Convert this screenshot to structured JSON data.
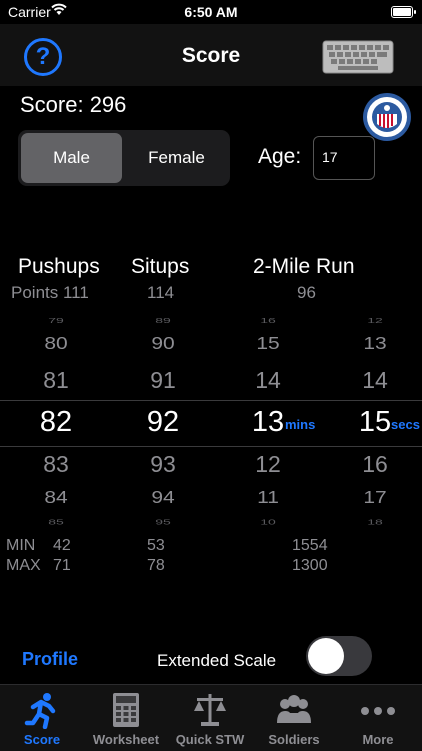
{
  "status_bar": {
    "carrier": "Carrier",
    "time": "6:50 AM"
  },
  "nav": {
    "title": "Score",
    "help_glyph": "?",
    "help_icon": "question-circle-icon",
    "keyboard_icon": "keyboard-icon"
  },
  "score": {
    "label": "Score: 296"
  },
  "gender": {
    "options": [
      "Male",
      "Female"
    ],
    "selected": "Male"
  },
  "age": {
    "label": "Age:",
    "value": "17"
  },
  "columns": {
    "pushups": {
      "header": "Pushups"
    },
    "situps": {
      "header": "Situps"
    },
    "run": {
      "header": "2-Mile Run"
    }
  },
  "points": {
    "label": "Points 111",
    "situps": "114",
    "run": "96"
  },
  "picker": {
    "pushups": [
      "79",
      "80",
      "81",
      "82",
      "83",
      "84",
      "85"
    ],
    "situps": [
      "89",
      "90",
      "91",
      "92",
      "93",
      "94",
      "95"
    ],
    "mins": [
      "16",
      "15",
      "14",
      "13",
      "12",
      "11",
      "10"
    ],
    "secs": [
      "12",
      "13",
      "14",
      "15",
      "16",
      "17",
      "18"
    ],
    "mins_unit": "mins",
    "secs_unit": "secs"
  },
  "limits": {
    "min_label": "MIN",
    "max_label": "MAX",
    "pushups_min": "42",
    "pushups_max": "71",
    "situps_min": "53",
    "situps_max": "78",
    "run_min": "1554",
    "run_max": "1300"
  },
  "footer": {
    "profile": "Profile",
    "extended_scale": "Extended Scale",
    "extended_scale_on": false
  },
  "tabs": [
    {
      "label": "Score",
      "icon": "runner-icon",
      "active": true
    },
    {
      "label": "Worksheet",
      "icon": "calculator-icon",
      "active": false
    },
    {
      "label": "Quick STW",
      "icon": "scales-icon",
      "active": false
    },
    {
      "label": "Soldiers",
      "icon": "group-icon",
      "active": false
    },
    {
      "label": "More",
      "icon": "more-dots-icon",
      "active": false
    }
  ],
  "colors": {
    "accent": "#1f78ff",
    "background": "#000000",
    "segment_selected": "#636366"
  }
}
